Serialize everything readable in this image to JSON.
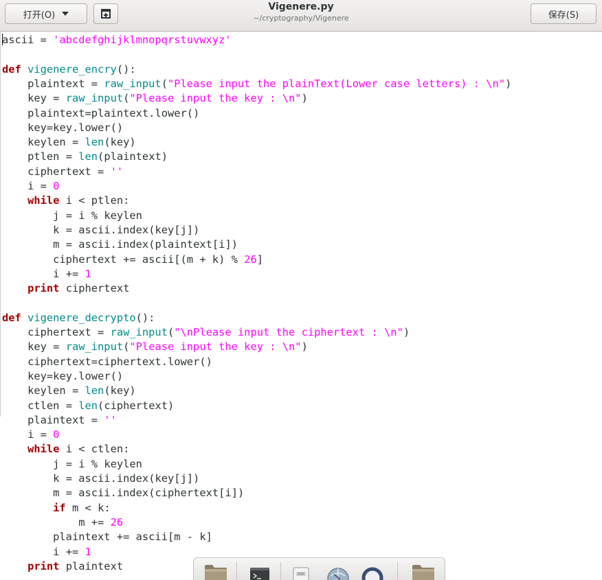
{
  "header": {
    "open_label": "打开(O)",
    "save_label": "保存(S)",
    "title": "Vigenere.py",
    "subtitle": "~/cryptography/Vigenere"
  },
  "editor": {
    "lines": [
      "ascii = 'abcdefghijklmnopqrstuvwxyz'",
      "",
      "def vigenere_encry():",
      "    plaintext = raw_input(\"Please input the plainText(Lower case letters) : \\n\")",
      "    key = raw_input(\"Please input the key : \\n\")",
      "    plaintext=plaintext.lower()",
      "    key=key.lower()",
      "    keylen = len(key)",
      "    ptlen = len(plaintext)",
      "    ciphertext = ''",
      "    i = 0",
      "    while i < ptlen:",
      "        j = i % keylen",
      "        k = ascii.index(key[j])",
      "        m = ascii.index(plaintext[i])",
      "        ciphertext += ascii[(m + k) % 26]",
      "        i += 1",
      "    print ciphertext",
      "",
      "def vigenere_decrypto():",
      "    ciphertext = raw_input(\"\\nPlease input the ciphertext : \\n\")",
      "    key = raw_input(\"Please input the key : \\n\")",
      "    ciphertext=ciphertext.lower()",
      "    key=key.lower()",
      "    keylen = len(key)",
      "    ctlen = len(ciphertext)",
      "    plaintext = ''",
      "    i = 0",
      "    while i < ctlen:",
      "        j = i % keylen",
      "        k = ascii.index(key[j])",
      "        m = ascii.index(ciphertext[i])",
      "        if m < k:",
      "            m += 26",
      "        plaintext += ascii[m - k]",
      "        i += 1",
      "    print plaintext"
    ]
  },
  "dock": {
    "items": [
      {
        "icon": "folder-icon"
      },
      {
        "icon": "terminal-icon"
      },
      {
        "icon": "text-editor-icon"
      },
      {
        "icon": "web-browser-icon"
      },
      {
        "icon": "search-icon"
      },
      {
        "icon": "folder-icon"
      }
    ]
  }
}
